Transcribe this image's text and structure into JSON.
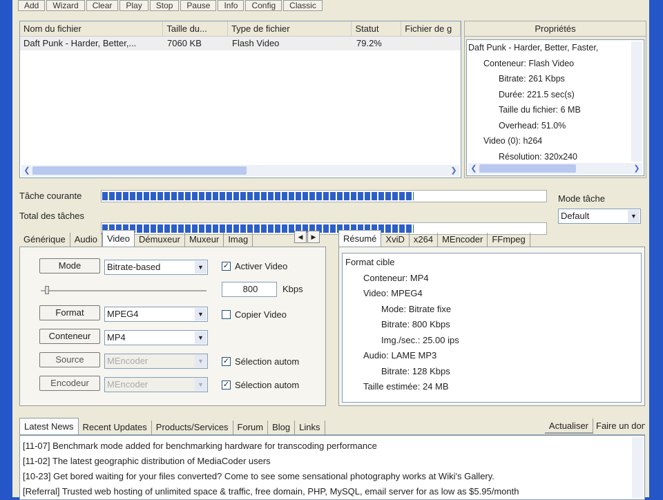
{
  "toolbar": [
    "Add",
    "Wizard",
    "Clear",
    "Play",
    "Stop",
    "Pause",
    "Info",
    "Config",
    "Classic"
  ],
  "file_list": {
    "columns": [
      "Nom du fichier",
      "Taille du...",
      "Type de fichier",
      "Statut",
      "Fichier de g"
    ],
    "rows": [
      {
        "name": "Daft Punk - Harder, Better,...",
        "size": "7060 KB",
        "type": "Flash Video",
        "status": "79.2%"
      }
    ]
  },
  "properties": {
    "title": "Propriétés",
    "items": [
      "Daft Punk - Harder, Better, Faster,",
      "Conteneur: Flash Video",
      "Bitrate: 261 Kbps",
      "Durée: 221.5 sec(s)",
      "Taille du fichier: 6 MB",
      "Overhead: 51.0%",
      "Video (0): h264",
      "Résolution: 320x240"
    ]
  },
  "progress": {
    "current_label": "Tâche courante",
    "current": 0.7,
    "total_label": "Total des tâches",
    "total": 0.7
  },
  "mode": {
    "label": "Mode tâche",
    "value": "Default"
  },
  "left_tabs": [
    "Générique",
    "Audio",
    "Video",
    "Démuxeur",
    "Muxeur",
    "Imag"
  ],
  "video": {
    "mode_btn": "Mode",
    "mode_val": "Bitrate-based",
    "activate": "Activer Video",
    "bitrate": "800",
    "unit": "Kbps",
    "format_btn": "Format",
    "format_val": "MPEG4",
    "copy": "Copier Video",
    "container_btn": "Conteneur",
    "container_val": "MP4",
    "source_btn": "Source",
    "source_val": "MEncoder",
    "auto1": "Sélection autom",
    "encoder_btn": "Encodeur",
    "encoder_val": "MEncoder",
    "auto2": "Sélection autom"
  },
  "right_tabs": [
    "Résumé",
    "XviD",
    "x264",
    "MEncoder",
    "FFmpeg"
  ],
  "summary": [
    [
      "0",
      "Format cible"
    ],
    [
      "1",
      "Conteneur: MP4"
    ],
    [
      "1",
      "Video: MPEG4"
    ],
    [
      "2",
      "Mode: Bitrate fixe"
    ],
    [
      "2",
      "Bitrate: 800 Kbps"
    ],
    [
      "2",
      "Img./sec.: 25.00 ips"
    ],
    [
      "1",
      "Audio: LAME MP3"
    ],
    [
      "2",
      "Bitrate: 128 Kbps"
    ],
    [
      "1",
      "Taille estimée: 24 MB"
    ]
  ],
  "news_tabs": [
    "Latest News",
    "Recent Updates",
    "Products/Services",
    "Forum",
    "Blog",
    "Links"
  ],
  "news_buttons": [
    "Actualiser",
    "Faire un don"
  ],
  "news": [
    "[11-07] Benchmark mode added for benchmarking hardware for transcoding performance",
    "[11-02] The latest geographic distribution of MediaCoder users",
    "[10-23] Get bored waiting for your files converted? Come to see some sensational photography works at Wiki's Gallery.",
    "[Referral] Trusted web hosting of unlimited space & traffic, free domain, PHP, MySQL, email server for as low as $5.95/month"
  ]
}
